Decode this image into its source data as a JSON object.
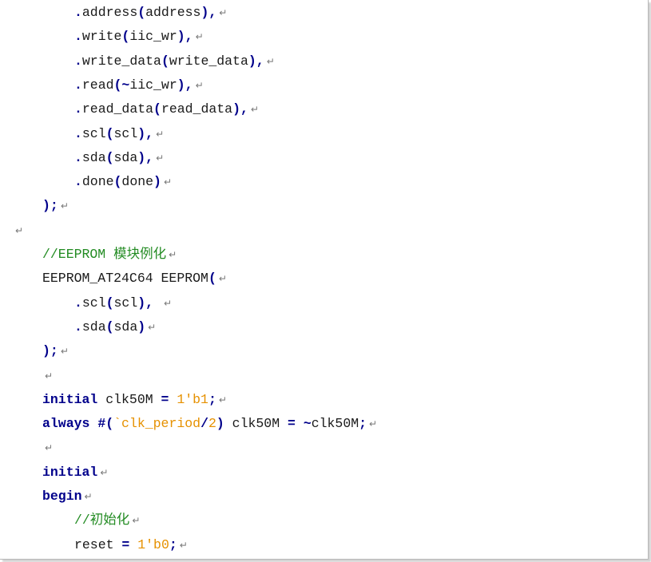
{
  "lines": [
    {
      "indent": 2,
      "tokens": [
        [
          "p",
          "."
        ],
        [
          "t",
          "address"
        ],
        [
          "p",
          "("
        ],
        [
          "t",
          "address"
        ],
        [
          "p",
          ")"
        ],
        [
          "p",
          ","
        ]
      ]
    },
    {
      "indent": 2,
      "tokens": [
        [
          "p",
          "."
        ],
        [
          "t",
          "write"
        ],
        [
          "p",
          "("
        ],
        [
          "t",
          "iic_wr"
        ],
        [
          "p",
          ")"
        ],
        [
          "p",
          ","
        ]
      ]
    },
    {
      "indent": 2,
      "tokens": [
        [
          "p",
          "."
        ],
        [
          "t",
          "write_data"
        ],
        [
          "p",
          "("
        ],
        [
          "t",
          "write_data"
        ],
        [
          "p",
          ")"
        ],
        [
          "p",
          ","
        ]
      ]
    },
    {
      "indent": 2,
      "tokens": [
        [
          "p",
          "."
        ],
        [
          "t",
          "read"
        ],
        [
          "p",
          "("
        ],
        [
          "p",
          "~"
        ],
        [
          "t",
          "iic_wr"
        ],
        [
          "p",
          ")"
        ],
        [
          "p",
          ","
        ]
      ]
    },
    {
      "indent": 2,
      "tokens": [
        [
          "p",
          "."
        ],
        [
          "t",
          "read_data"
        ],
        [
          "p",
          "("
        ],
        [
          "t",
          "read_data"
        ],
        [
          "p",
          ")"
        ],
        [
          "p",
          ","
        ]
      ]
    },
    {
      "indent": 2,
      "tokens": [
        [
          "p",
          "."
        ],
        [
          "t",
          "scl"
        ],
        [
          "p",
          "("
        ],
        [
          "t",
          "scl"
        ],
        [
          "p",
          ")"
        ],
        [
          "p",
          ","
        ]
      ]
    },
    {
      "indent": 2,
      "tokens": [
        [
          "p",
          "."
        ],
        [
          "t",
          "sda"
        ],
        [
          "p",
          "("
        ],
        [
          "t",
          "sda"
        ],
        [
          "p",
          ")"
        ],
        [
          "p",
          ","
        ]
      ]
    },
    {
      "indent": 2,
      "tokens": [
        [
          "p",
          "."
        ],
        [
          "t",
          "done"
        ],
        [
          "p",
          "("
        ],
        [
          "t",
          "done"
        ],
        [
          "p",
          ")"
        ]
      ]
    },
    {
      "indent": 1,
      "tokens": [
        [
          "p",
          ")"
        ],
        [
          "p",
          ";"
        ]
      ]
    },
    {
      "indent": 0,
      "tokens": []
    },
    {
      "indent": 1,
      "tokens": [
        [
          "c",
          "//EEPROM 模块例化"
        ]
      ]
    },
    {
      "indent": 1,
      "tokens": [
        [
          "t",
          "EEPROM_AT24C64 EEPROM"
        ],
        [
          "p",
          "("
        ]
      ]
    },
    {
      "indent": 2,
      "tokens": [
        [
          "p",
          "."
        ],
        [
          "t",
          "scl"
        ],
        [
          "p",
          "("
        ],
        [
          "t",
          "scl"
        ],
        [
          "p",
          ")"
        ],
        [
          "p",
          ","
        ],
        [
          "t",
          " "
        ]
      ]
    },
    {
      "indent": 2,
      "tokens": [
        [
          "p",
          "."
        ],
        [
          "t",
          "sda"
        ],
        [
          "p",
          "("
        ],
        [
          "t",
          "sda"
        ],
        [
          "p",
          ")"
        ]
      ]
    },
    {
      "indent": 1,
      "tokens": [
        [
          "p",
          ")"
        ],
        [
          "p",
          ";"
        ]
      ]
    },
    {
      "indent": 1,
      "tokens": []
    },
    {
      "indent": 1,
      "tokens": [
        [
          "k",
          "initial"
        ],
        [
          "t",
          " clk50M "
        ],
        [
          "p",
          "="
        ],
        [
          "t",
          " "
        ],
        [
          "n",
          "1'b1"
        ],
        [
          "p",
          ";"
        ]
      ]
    },
    {
      "indent": 1,
      "tokens": [
        [
          "k",
          "always"
        ],
        [
          "t",
          " "
        ],
        [
          "p",
          "#"
        ],
        [
          "p",
          "("
        ],
        [
          "n",
          "`clk_period"
        ],
        [
          "p",
          "/"
        ],
        [
          "n",
          "2"
        ],
        [
          "p",
          ")"
        ],
        [
          "t",
          " clk50M "
        ],
        [
          "p",
          "="
        ],
        [
          "t",
          " "
        ],
        [
          "p",
          "~"
        ],
        [
          "t",
          "clk50M"
        ],
        [
          "p",
          ";"
        ]
      ]
    },
    {
      "indent": 1,
      "tokens": []
    },
    {
      "indent": 1,
      "tokens": [
        [
          "k",
          "initial"
        ]
      ]
    },
    {
      "indent": 1,
      "tokens": [
        [
          "k",
          "begin"
        ]
      ]
    },
    {
      "indent": 2,
      "tokens": [
        [
          "c",
          "//初始化"
        ]
      ]
    },
    {
      "indent": 2,
      "tokens": [
        [
          "t",
          "reset "
        ],
        [
          "p",
          "="
        ],
        [
          "t",
          " "
        ],
        [
          "n",
          "1'b0"
        ],
        [
          "p",
          ";"
        ]
      ]
    }
  ],
  "return_mark": "↵"
}
